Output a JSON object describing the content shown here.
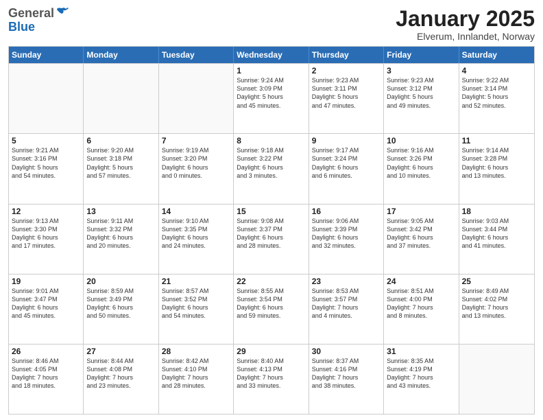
{
  "logo": {
    "general": "General",
    "blue": "Blue"
  },
  "header": {
    "month": "January 2025",
    "location": "Elverum, Innlandet, Norway"
  },
  "weekdays": [
    "Sunday",
    "Monday",
    "Tuesday",
    "Wednesday",
    "Thursday",
    "Friday",
    "Saturday"
  ],
  "weeks": [
    [
      {
        "day": "",
        "info": "",
        "empty": true
      },
      {
        "day": "",
        "info": "",
        "empty": true
      },
      {
        "day": "",
        "info": "",
        "empty": true
      },
      {
        "day": "1",
        "info": "Sunrise: 9:24 AM\nSunset: 3:09 PM\nDaylight: 5 hours\nand 45 minutes."
      },
      {
        "day": "2",
        "info": "Sunrise: 9:23 AM\nSunset: 3:11 PM\nDaylight: 5 hours\nand 47 minutes."
      },
      {
        "day": "3",
        "info": "Sunrise: 9:23 AM\nSunset: 3:12 PM\nDaylight: 5 hours\nand 49 minutes."
      },
      {
        "day": "4",
        "info": "Sunrise: 9:22 AM\nSunset: 3:14 PM\nDaylight: 5 hours\nand 52 minutes."
      }
    ],
    [
      {
        "day": "5",
        "info": "Sunrise: 9:21 AM\nSunset: 3:16 PM\nDaylight: 5 hours\nand 54 minutes."
      },
      {
        "day": "6",
        "info": "Sunrise: 9:20 AM\nSunset: 3:18 PM\nDaylight: 5 hours\nand 57 minutes."
      },
      {
        "day": "7",
        "info": "Sunrise: 9:19 AM\nSunset: 3:20 PM\nDaylight: 6 hours\nand 0 minutes."
      },
      {
        "day": "8",
        "info": "Sunrise: 9:18 AM\nSunset: 3:22 PM\nDaylight: 6 hours\nand 3 minutes."
      },
      {
        "day": "9",
        "info": "Sunrise: 9:17 AM\nSunset: 3:24 PM\nDaylight: 6 hours\nand 6 minutes."
      },
      {
        "day": "10",
        "info": "Sunrise: 9:16 AM\nSunset: 3:26 PM\nDaylight: 6 hours\nand 10 minutes."
      },
      {
        "day": "11",
        "info": "Sunrise: 9:14 AM\nSunset: 3:28 PM\nDaylight: 6 hours\nand 13 minutes."
      }
    ],
    [
      {
        "day": "12",
        "info": "Sunrise: 9:13 AM\nSunset: 3:30 PM\nDaylight: 6 hours\nand 17 minutes."
      },
      {
        "day": "13",
        "info": "Sunrise: 9:11 AM\nSunset: 3:32 PM\nDaylight: 6 hours\nand 20 minutes."
      },
      {
        "day": "14",
        "info": "Sunrise: 9:10 AM\nSunset: 3:35 PM\nDaylight: 6 hours\nand 24 minutes."
      },
      {
        "day": "15",
        "info": "Sunrise: 9:08 AM\nSunset: 3:37 PM\nDaylight: 6 hours\nand 28 minutes."
      },
      {
        "day": "16",
        "info": "Sunrise: 9:06 AM\nSunset: 3:39 PM\nDaylight: 6 hours\nand 32 minutes."
      },
      {
        "day": "17",
        "info": "Sunrise: 9:05 AM\nSunset: 3:42 PM\nDaylight: 6 hours\nand 37 minutes."
      },
      {
        "day": "18",
        "info": "Sunrise: 9:03 AM\nSunset: 3:44 PM\nDaylight: 6 hours\nand 41 minutes."
      }
    ],
    [
      {
        "day": "19",
        "info": "Sunrise: 9:01 AM\nSunset: 3:47 PM\nDaylight: 6 hours\nand 45 minutes."
      },
      {
        "day": "20",
        "info": "Sunrise: 8:59 AM\nSunset: 3:49 PM\nDaylight: 6 hours\nand 50 minutes."
      },
      {
        "day": "21",
        "info": "Sunrise: 8:57 AM\nSunset: 3:52 PM\nDaylight: 6 hours\nand 54 minutes."
      },
      {
        "day": "22",
        "info": "Sunrise: 8:55 AM\nSunset: 3:54 PM\nDaylight: 6 hours\nand 59 minutes."
      },
      {
        "day": "23",
        "info": "Sunrise: 8:53 AM\nSunset: 3:57 PM\nDaylight: 7 hours\nand 4 minutes."
      },
      {
        "day": "24",
        "info": "Sunrise: 8:51 AM\nSunset: 4:00 PM\nDaylight: 7 hours\nand 8 minutes."
      },
      {
        "day": "25",
        "info": "Sunrise: 8:49 AM\nSunset: 4:02 PM\nDaylight: 7 hours\nand 13 minutes."
      }
    ],
    [
      {
        "day": "26",
        "info": "Sunrise: 8:46 AM\nSunset: 4:05 PM\nDaylight: 7 hours\nand 18 minutes."
      },
      {
        "day": "27",
        "info": "Sunrise: 8:44 AM\nSunset: 4:08 PM\nDaylight: 7 hours\nand 23 minutes."
      },
      {
        "day": "28",
        "info": "Sunrise: 8:42 AM\nSunset: 4:10 PM\nDaylight: 7 hours\nand 28 minutes."
      },
      {
        "day": "29",
        "info": "Sunrise: 8:40 AM\nSunset: 4:13 PM\nDaylight: 7 hours\nand 33 minutes."
      },
      {
        "day": "30",
        "info": "Sunrise: 8:37 AM\nSunset: 4:16 PM\nDaylight: 7 hours\nand 38 minutes."
      },
      {
        "day": "31",
        "info": "Sunrise: 8:35 AM\nSunset: 4:19 PM\nDaylight: 7 hours\nand 43 minutes."
      },
      {
        "day": "",
        "info": "",
        "empty": true
      }
    ]
  ]
}
